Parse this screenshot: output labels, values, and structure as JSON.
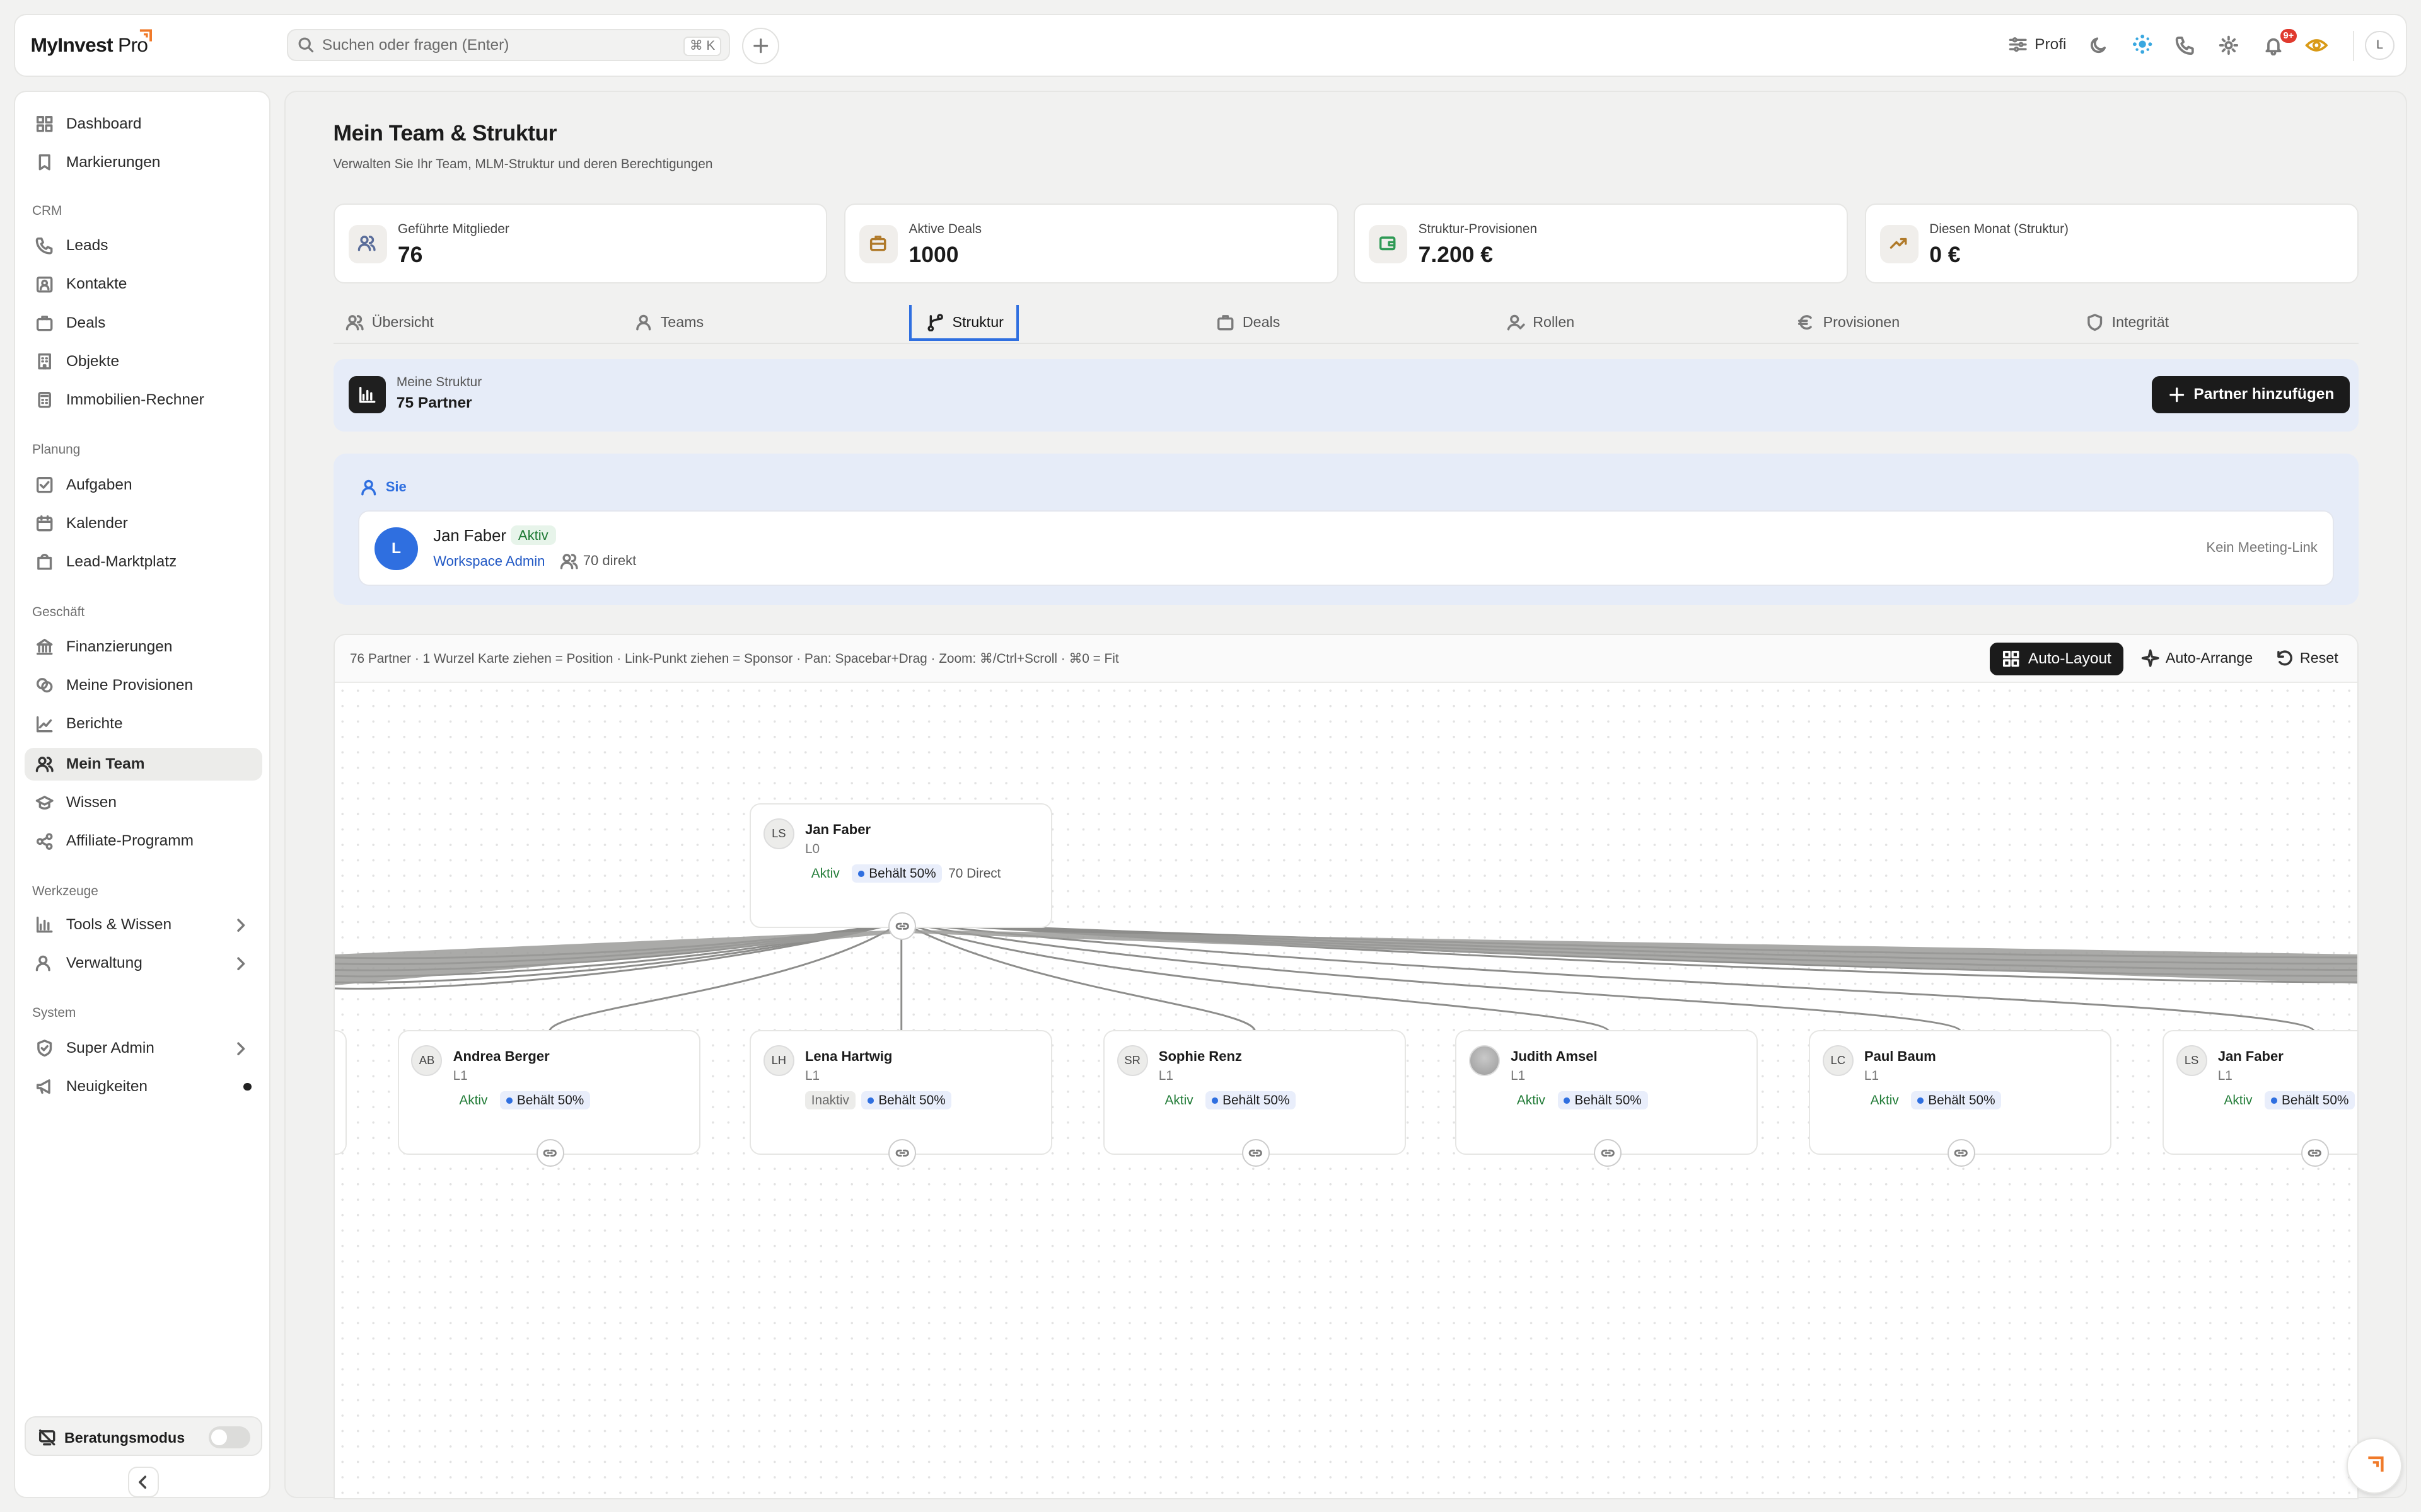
{
  "header": {
    "logo_main": "MyInvest",
    "logo_sub": " Pro",
    "search_placeholder": "Suchen oder fragen (Enter)",
    "search_shortcut": "⌘ K",
    "profi_label": "Profi",
    "notifications_badge": "9+",
    "user_initial": "L"
  },
  "sidebar": {
    "top": [
      {
        "label": "Dashboard",
        "icon": "grid-icon"
      },
      {
        "label": "Markierungen",
        "icon": "bookmark-icon"
      }
    ],
    "sections": [
      {
        "title": "CRM",
        "items": [
          {
            "label": "Leads",
            "icon": "phone-icon"
          },
          {
            "label": "Kontakte",
            "icon": "contact-icon"
          },
          {
            "label": "Deals",
            "icon": "briefcase-icon"
          },
          {
            "label": "Objekte",
            "icon": "building-icon"
          },
          {
            "label": "Immobilien-Rechner",
            "icon": "calculator-icon"
          }
        ]
      },
      {
        "title": "Planung",
        "items": [
          {
            "label": "Aufgaben",
            "icon": "checkbox-icon"
          },
          {
            "label": "Kalender",
            "icon": "calendar-icon"
          },
          {
            "label": "Lead-Marktplatz",
            "icon": "shopping-bag-icon"
          }
        ]
      },
      {
        "title": "Geschäft",
        "items": [
          {
            "label": "Finanzierungen",
            "icon": "bank-icon"
          },
          {
            "label": "Meine Provisionen",
            "icon": "coins-icon"
          },
          {
            "label": "Berichte",
            "icon": "chart-line-icon"
          },
          {
            "label": "Mein Team",
            "icon": "users-icon"
          },
          {
            "label": "Wissen",
            "icon": "graduation-cap-icon"
          },
          {
            "label": "Affiliate-Programm",
            "icon": "share-icon"
          }
        ]
      },
      {
        "title": "Werkzeuge",
        "items": [
          {
            "label": "Tools & Wissen",
            "icon": "chart-bar-icon"
          },
          {
            "label": "Verwaltung",
            "icon": "user-cog-icon"
          }
        ]
      },
      {
        "title": "System",
        "items": [
          {
            "label": "Super Admin",
            "icon": "shield-check-icon"
          },
          {
            "label": "Neuigkeiten",
            "icon": "megaphone-icon"
          }
        ]
      }
    ],
    "beratungsmodus_label": "Beratungsmodus"
  },
  "main": {
    "title": "Mein Team & Struktur",
    "subtitle": "Verwalten Sie Ihr Team, MLM-Struktur und deren Berechtigungen",
    "stats": [
      {
        "label": "Geführte Mitglieder",
        "value": "76",
        "icon": "users-icon",
        "color": "#5a6d9a"
      },
      {
        "label": "Aktive Deals",
        "value": "1000",
        "icon": "briefcase-icon",
        "color": "#b07a2a"
      },
      {
        "label": "Struktur-Provisionen",
        "value": "7.200 €",
        "icon": "wallet-icon",
        "color": "#2f9a55"
      },
      {
        "label": "Diesen Monat (Struktur)",
        "value": "0 €",
        "icon": "trending-up-icon",
        "color": "#b07a2a"
      }
    ],
    "tabs": [
      {
        "label": "Übersicht",
        "icon": "users-icon"
      },
      {
        "label": "Teams",
        "icon": "user-icon"
      },
      {
        "label": "Struktur",
        "icon": "git-branch-icon",
        "active": true
      },
      {
        "label": "Deals",
        "icon": "briefcase-icon"
      },
      {
        "label": "Rollen",
        "icon": "user-check-icon"
      },
      {
        "label": "Provisionen",
        "icon": "euro-icon"
      },
      {
        "label": "Integrität",
        "icon": "shield-icon"
      }
    ],
    "structure": {
      "label": "Meine Struktur",
      "value": "75 Partner",
      "add_button": "Partner hinzufügen"
    },
    "you": {
      "section_label": "Sie",
      "initial": "L",
      "name": "Jan Faber",
      "status": "Aktiv",
      "role": "Workspace Admin",
      "direct": "70 direkt",
      "meeting": "Kein Meeting-Link"
    },
    "canvas": {
      "info": "76 Partner · 1 Wurzel   Karte ziehen = Position · Link-Punkt ziehen = Sponsor · Pan: Spacebar+Drag · Zoom: ⌘/Ctrl+Scroll · ⌘0 = Fit",
      "auto_layout": "Auto-Layout",
      "auto_arrange": "Auto-Arrange",
      "reset": "Reset",
      "root": {
        "initials": "LS",
        "name": "Jan Faber",
        "level": "L0",
        "status": "Aktiv",
        "share": "Behält 50%",
        "direct": "70 Direct"
      },
      "children": [
        {
          "initials": "AB",
          "name": "Andrea Berger",
          "level": "L1",
          "status": "Aktiv",
          "share": "Behält 50%"
        },
        {
          "initials": "LH",
          "name": "Lena Hartwig",
          "level": "L1",
          "status": "Inaktiv",
          "share": "Behält 50%"
        },
        {
          "initials": "SR",
          "name": "Sophie Renz",
          "level": "L1",
          "status": "Aktiv",
          "share": "Behält 50%"
        },
        {
          "initials": "",
          "name": "Judith Amsel",
          "level": "L1",
          "status": "Aktiv",
          "share": "Behält 50%"
        },
        {
          "initials": "LC",
          "name": "Paul Baum",
          "level": "L1",
          "status": "Aktiv",
          "share": "Behält 50%"
        },
        {
          "initials": "LS",
          "name": "Jan Faber",
          "level": "L1",
          "status": "Aktiv",
          "share": "Behält 50%"
        }
      ]
    }
  }
}
